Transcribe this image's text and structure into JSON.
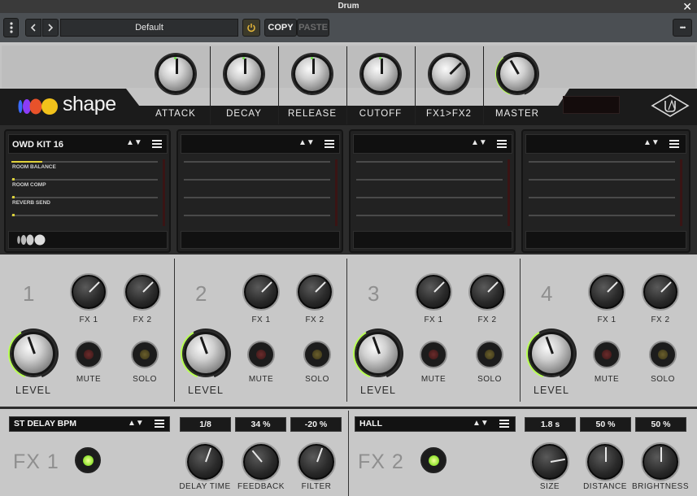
{
  "window": {
    "title": "Drum"
  },
  "toolbar": {
    "preset": "Default",
    "copy_label": "COPY",
    "paste_label": "PASTE",
    "more_label": "•••"
  },
  "brand": {
    "logo_text": "shape"
  },
  "top_controls": [
    {
      "label": "ATTACK"
    },
    {
      "label": "DECAY"
    },
    {
      "label": "RELEASE"
    },
    {
      "label": "CUTOFF"
    },
    {
      "label": "FX1>FX2"
    },
    {
      "label": "MASTER"
    }
  ],
  "slots": [
    {
      "name": "OWD KIT 16",
      "params": [
        {
          "label": "ROOM BALANCE",
          "level": 0.25
        },
        {
          "label": "ROOM COMP",
          "level": 0.0
        },
        {
          "label": "REVERB SEND",
          "level": 0.0
        },
        {
          "label": "",
          "level": 0.0
        }
      ]
    },
    {
      "name": "",
      "params": []
    },
    {
      "name": "",
      "params": []
    },
    {
      "name": "",
      "params": []
    }
  ],
  "channels": [
    {
      "number": "1",
      "fx1": "FX 1",
      "fx2": "FX 2",
      "mute": "MUTE",
      "solo": "SOLO",
      "level": "LEVEL"
    },
    {
      "number": "2",
      "fx1": "FX 1",
      "fx2": "FX 2",
      "mute": "MUTE",
      "solo": "SOLO",
      "level": "LEVEL"
    },
    {
      "number": "3",
      "fx1": "FX 1",
      "fx2": "FX 2",
      "mute": "MUTE",
      "solo": "SOLO",
      "level": "LEVEL"
    },
    {
      "number": "4",
      "fx1": "FX 1",
      "fx2": "FX 2",
      "mute": "MUTE",
      "solo": "SOLO",
      "level": "LEVEL"
    }
  ],
  "fx1": {
    "title": "FX 1",
    "type": "ST DELAY BPM",
    "values": [
      "1/8",
      "34 %",
      "-20 %"
    ],
    "labels": [
      "DELAY TIME",
      "FEEDBACK",
      "FILTER"
    ]
  },
  "fx2": {
    "title": "FX 2",
    "type": "HALL",
    "values": [
      "1.8 s",
      "50 %",
      "50 %"
    ],
    "labels": [
      "SIZE",
      "DISTANCE",
      "BRIGHTNESS"
    ]
  },
  "colors": {
    "accent_green": "#b7ff52",
    "panel_gray": "#c6c6c6",
    "dark": "#1b1b1b"
  }
}
